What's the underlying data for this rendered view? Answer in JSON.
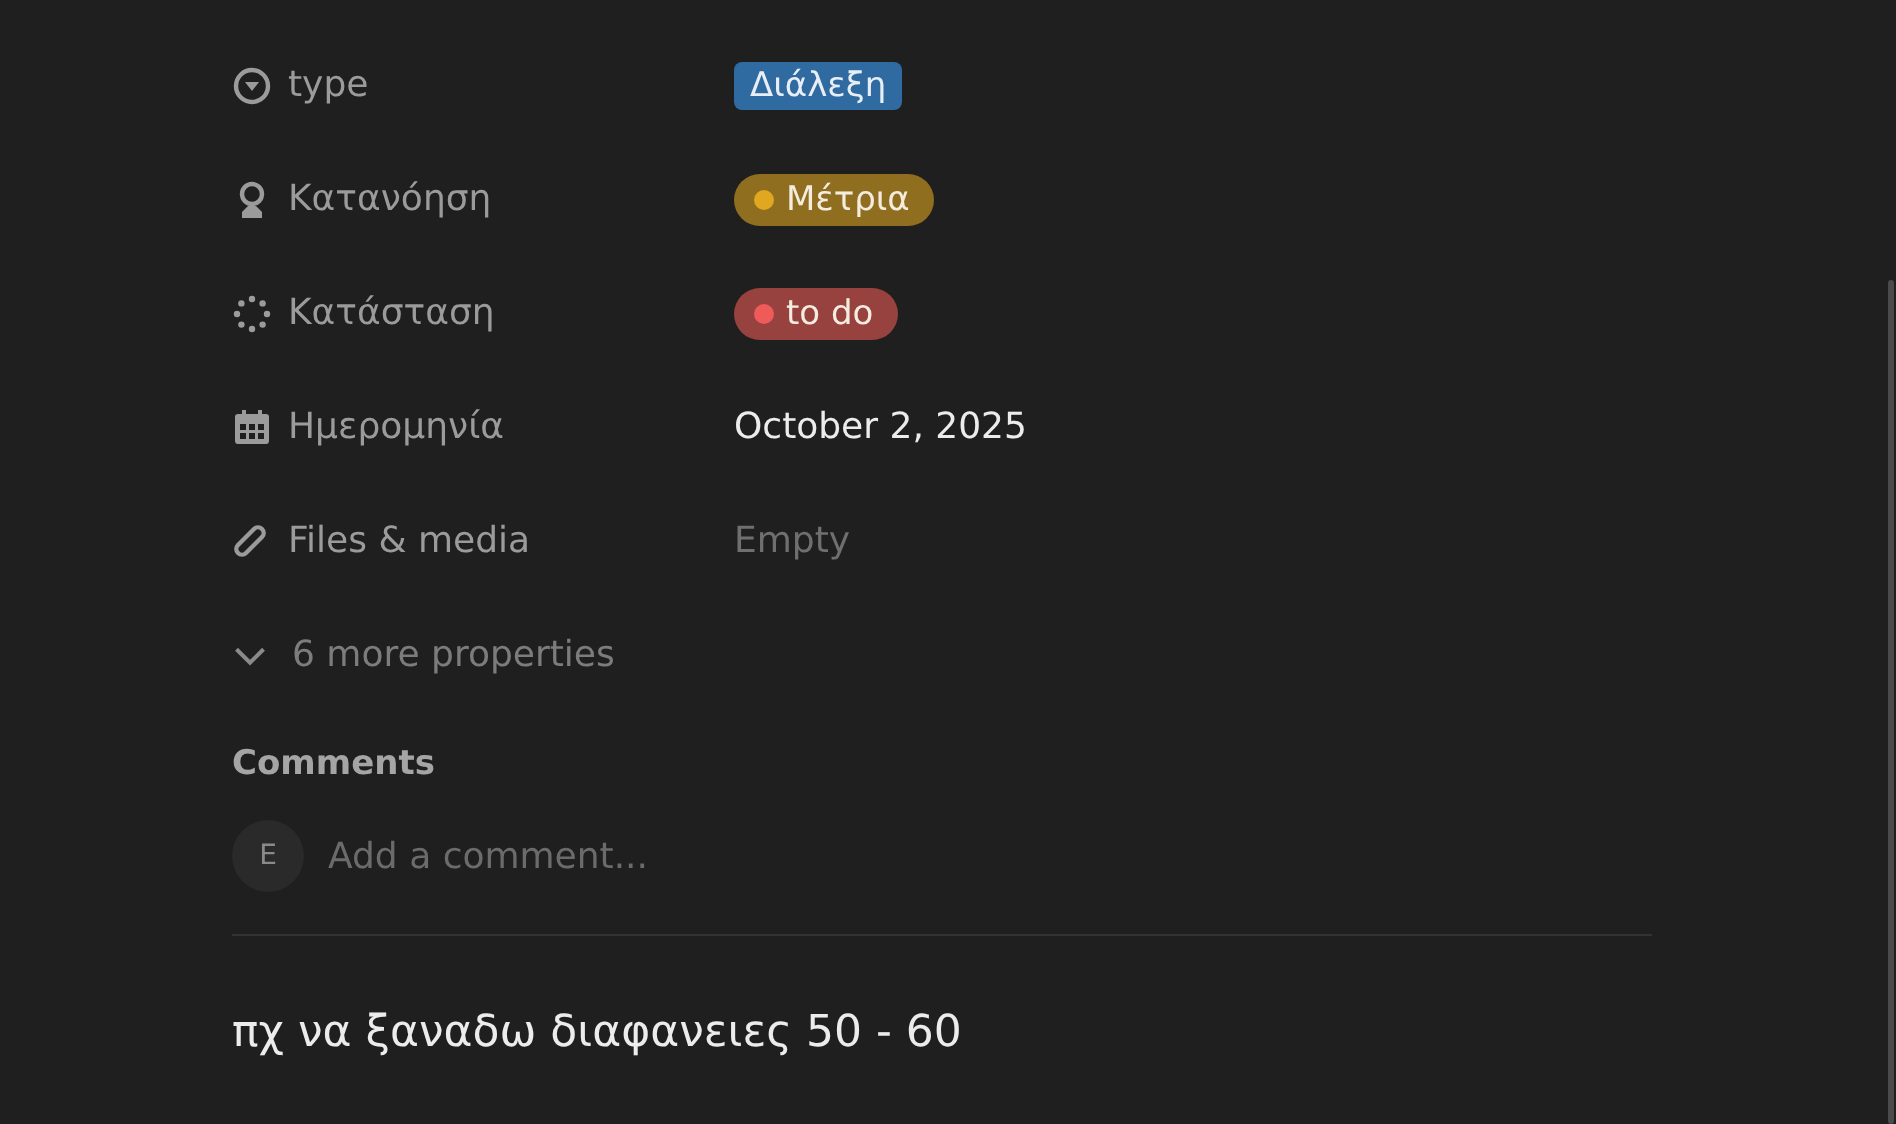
{
  "properties": [
    {
      "label": "type",
      "kind": "select",
      "value": "Διάλεξη",
      "color": "#2f6aa0"
    },
    {
      "label": "Κατανόηση",
      "kind": "status",
      "value": "Μέτρια",
      "color": "#e0a820"
    },
    {
      "label": "Κατάσταση",
      "kind": "status",
      "value": "to do",
      "color": "#ef5b58"
    },
    {
      "label": "Ημερομηνία",
      "kind": "date",
      "value": "October 2, 2025"
    },
    {
      "label": "Files & media",
      "kind": "empty",
      "value": "Empty"
    }
  ],
  "more_properties": {
    "label": "6 more properties",
    "expanded": false
  },
  "comments": {
    "title": "Comments",
    "avatar": "E",
    "placeholder": "Add a comment..."
  },
  "body": "πχ να ξαναδω διαφανειες 50 - 60"
}
